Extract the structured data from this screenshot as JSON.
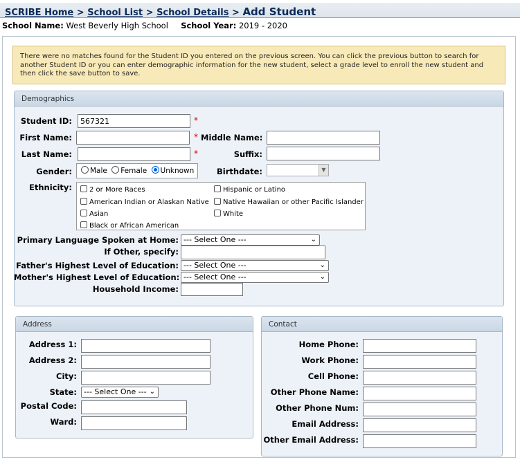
{
  "breadcrumb": {
    "home": "SCRIBE Home",
    "sep1": ">",
    "school_list": "School List",
    "sep2": ">",
    "school_details": "School Details",
    "sep3": ">",
    "current": "Add Student"
  },
  "school": {
    "name_label": "School Name:",
    "name_value": "West Beverly High School",
    "year_label": "School Year:",
    "year_value": "2019 - 2020"
  },
  "notice": "There were no matches found for the Student ID you entered on the previous screen. You can click the previous button to search for another Student ID or you can enter demographic information for the new student, select a grade level to enroll the new student and then click the save button to save.",
  "demographics": {
    "header": "Demographics",
    "required_mark": "*",
    "student_id_label": "Student ID:",
    "student_id_value": "567321",
    "first_name_label": "First Name:",
    "middle_name_label": "Middle Name:",
    "last_name_label": "Last Name:",
    "suffix_label": "Suffix:",
    "gender_label": "Gender:",
    "gender_options": [
      "Male",
      "Female",
      "Unknown"
    ],
    "gender_selected": "Unknown",
    "birthdate_label": "Birthdate:",
    "ethnicity_label": "Ethnicity:",
    "ethnicity_options": [
      "2 or More Races",
      "Hispanic or Latino",
      "American Indian or Alaskan Native",
      "Native Hawaiian or other Pacific Islander",
      "Asian",
      "White",
      "Black or African American"
    ],
    "primary_language_label": "Primary Language Spoken at Home:",
    "primary_language_value": "--- Select One ---",
    "if_other_label": "If Other, specify:",
    "father_edu_label": "Father's Highest Level of Education:",
    "father_edu_value": "--- Select One ---",
    "mother_edu_label": "Mother's Highest Level of Education:",
    "mother_edu_value": "--- Select One ---",
    "income_label": "Household Income:"
  },
  "address": {
    "header": "Address",
    "address1_label": "Address 1:",
    "address2_label": "Address 2:",
    "city_label": "City:",
    "state_label": "State:",
    "state_value": "--- Select One ---",
    "postal_label": "Postal Code:",
    "ward_label": "Ward:"
  },
  "contact": {
    "header": "Contact",
    "home_phone_label": "Home Phone:",
    "work_phone_label": "Work Phone:",
    "cell_phone_label": "Cell Phone:",
    "other_phone_name_label": "Other Phone Name:",
    "other_phone_num_label": "Other Phone Num:",
    "email_label": "Email Address:",
    "other_email_label": "Other Email Address:"
  },
  "icons": {
    "dropdown": "chevron-down-icon"
  },
  "colors": {
    "notice_bg": "#f8eab8",
    "panel_bg": "#edf2f8",
    "required": "#dd0000",
    "radio_selected": "#0060df"
  }
}
